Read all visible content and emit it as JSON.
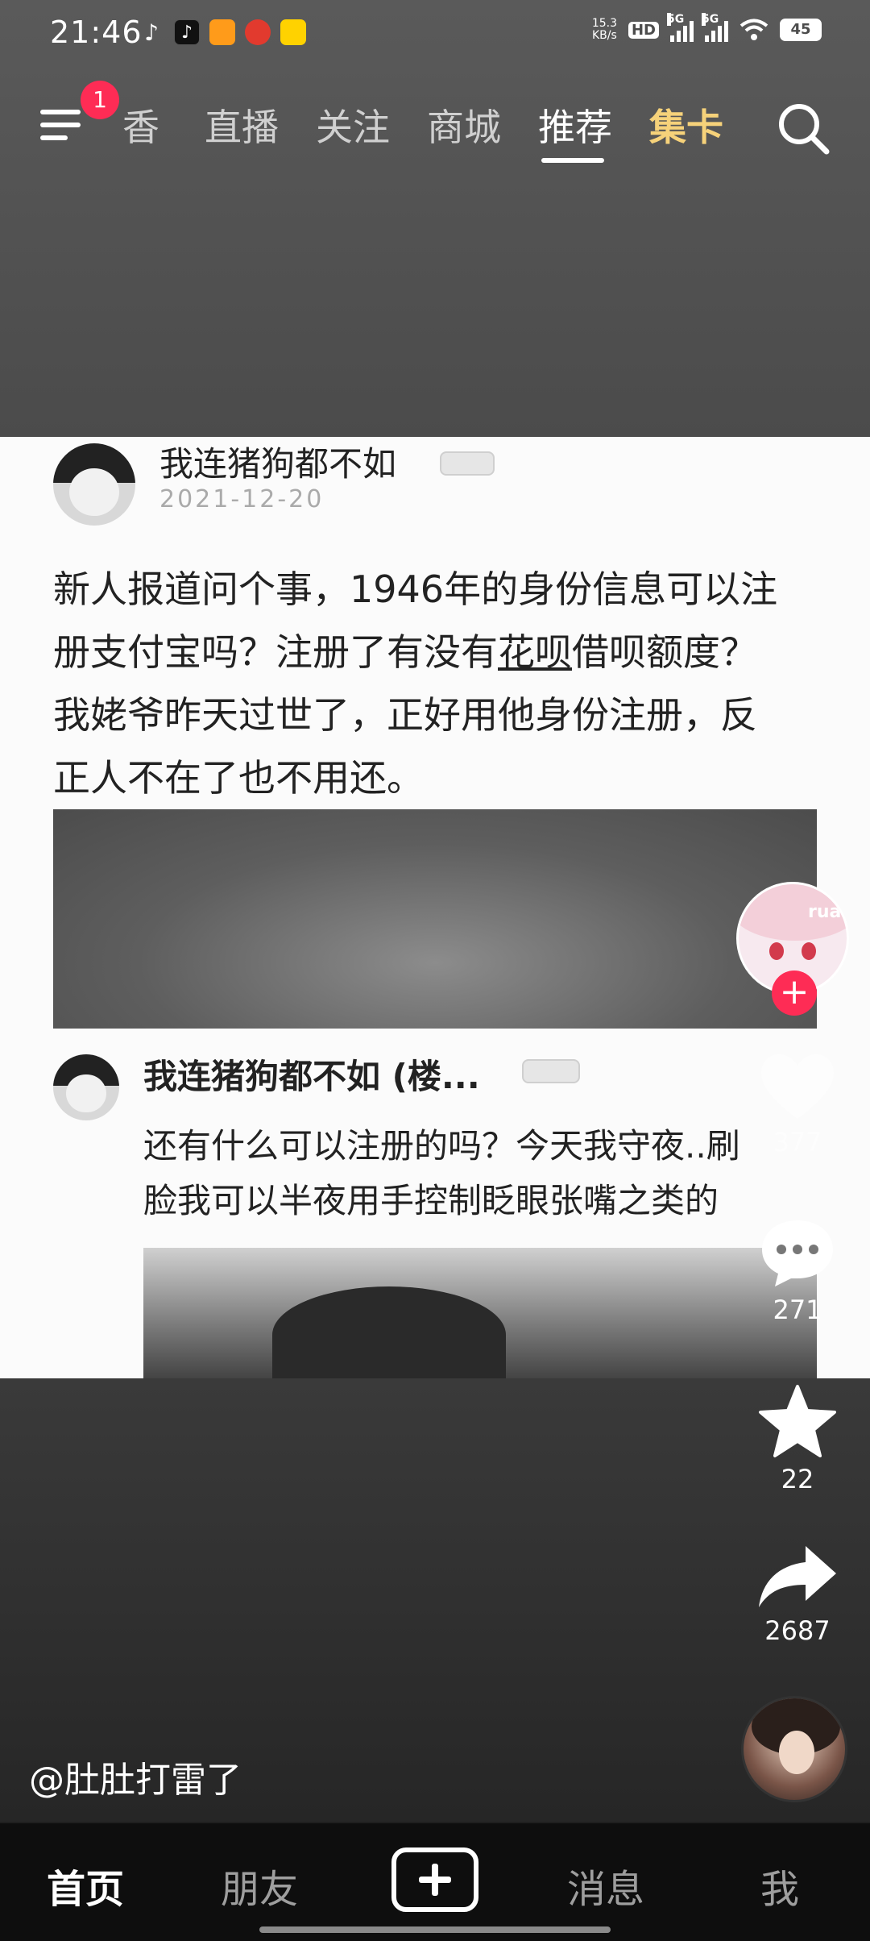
{
  "status_bar": {
    "time": "21:46",
    "net_speed_value": "15.3",
    "net_speed_unit": "KB/s",
    "hd_label": "HD",
    "network_1": "5G",
    "network_2": "5G",
    "battery": "45",
    "app_icons": [
      "tiktok-lite-icon",
      "tiktok-icon",
      "video-app-icon",
      "red-app-icon",
      "meituan-icon"
    ]
  },
  "top_nav": {
    "menu_badge": "1",
    "tabs": [
      {
        "label": "香"
      },
      {
        "label": "直播"
      },
      {
        "label": "关注"
      },
      {
        "label": "商城"
      },
      {
        "label": "推荐"
      },
      {
        "label": "集卡"
      }
    ],
    "active_tab": "推荐"
  },
  "post": {
    "user": "我连猪狗都不如",
    "date": "2021-12-20",
    "text_line1": "新人报道问个事，1946年的身份信息可以注",
    "text_line2a": "册支付宝吗？注册了有没有",
    "text_line2_underlined": "花呗",
    "text_line2b": "借呗额度？",
    "text_line3": "我姥爷昨天过世了，正好用他身份注册，反",
    "text_line4": "正人不在了也不用还。",
    "reply_user": "我连猪狗都不如 (楼...",
    "reply_line1": "还有什么可以注册的吗？今天我守夜..刷",
    "reply_line2": "脸我可以半夜用手控制眨眼张嘴之类的"
  },
  "actions": {
    "creator_avatar_text": "rua",
    "follow_icon": "plus-icon",
    "like_count": "377",
    "comment_count": "271",
    "favorite_count": "22",
    "share_count": "2687"
  },
  "author_handle": "@肚肚打雷了",
  "bottom_nav": {
    "home": "首页",
    "friends": "朋友",
    "messages": "消息",
    "me": "我"
  },
  "colors": {
    "accent_red": "#fe2c55",
    "gold_tab": "#f6d27a"
  }
}
